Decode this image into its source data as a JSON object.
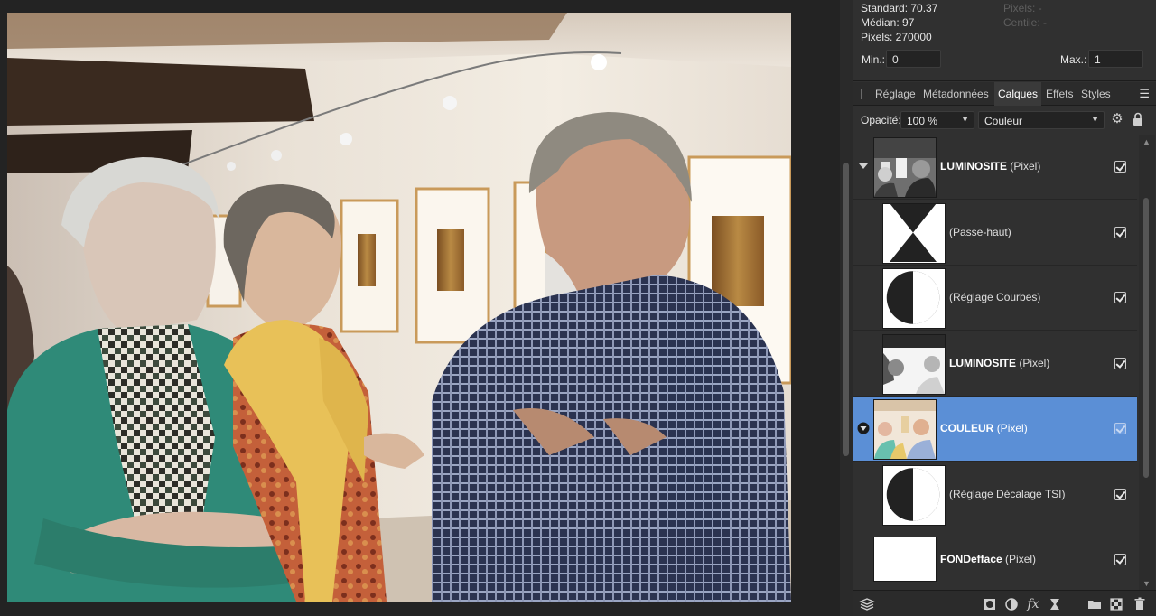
{
  "histogram": {
    "standard": "Standard: 70.37",
    "median": "Médian: 97",
    "pixels": "Pixels: 270000",
    "pixels_dim": "Pixels: -",
    "centile_dim": "Centile: -",
    "min_label": "Min.:",
    "min_value": "0",
    "max_label": "Max.:",
    "max_value": "1"
  },
  "tabs": [
    {
      "label": "Réglage",
      "active": false
    },
    {
      "label": "Métadonnées",
      "active": false
    },
    {
      "label": "Calques",
      "active": true
    },
    {
      "label": "Effets",
      "active": false
    },
    {
      "label": "Styles",
      "active": false
    }
  ],
  "tab_menu_icon": "panel-menu-icon",
  "opacity": {
    "label": "Opacité:",
    "value": "100 %",
    "blend_mode": "Couleur"
  },
  "layers": [
    {
      "name": "LUMINOSITE",
      "type": "(Pixel)",
      "bold": true,
      "expandable": true,
      "expanded": true,
      "thumb": "photo-gray",
      "badge": "",
      "visible": true,
      "selected": false,
      "indent": false
    },
    {
      "name": "",
      "type": "(Passe-haut)",
      "bold": false,
      "expandable": false,
      "expanded": false,
      "thumb": "white",
      "badge": "hourglass",
      "visible": true,
      "selected": false,
      "indent": true
    },
    {
      "name": "",
      "type": "(Réglage Courbes)",
      "bold": false,
      "expandable": false,
      "expanded": false,
      "thumb": "white",
      "badge": "adjustment",
      "visible": true,
      "selected": false,
      "indent": true
    },
    {
      "name": "LUMINOSITE",
      "type": "(Pixel)",
      "bold": true,
      "expandable": false,
      "expanded": false,
      "thumb": "photo-highkey",
      "badge": "",
      "visible": true,
      "selected": false,
      "indent": true
    },
    {
      "name": "COULEUR",
      "type": "(Pixel)",
      "bold": true,
      "expandable": true,
      "expanded": true,
      "thumb": "photo-color",
      "badge": "",
      "visible": true,
      "selected": true,
      "indent": false
    },
    {
      "name": "",
      "type": "(Réglage Décalage TSI)",
      "bold": false,
      "expandable": false,
      "expanded": false,
      "thumb": "white",
      "badge": "adjustment",
      "visible": true,
      "selected": false,
      "indent": true
    },
    {
      "name": "FONDefface",
      "type": "(Pixel)",
      "bold": true,
      "expandable": false,
      "expanded": false,
      "thumb": "white-wide",
      "badge": "",
      "visible": true,
      "selected": false,
      "indent": false
    }
  ],
  "footer_icons": [
    "layers-stack-icon",
    "mask-icon",
    "adjustment-icon",
    "fx-icon",
    "live-filter-icon",
    "group-folder-icon",
    "add-pixel-layer-icon",
    "delete-icon"
  ],
  "colors": {
    "selection": "#5b8fd6",
    "panel_bg": "#303030",
    "canvas_bg": "#232323"
  }
}
